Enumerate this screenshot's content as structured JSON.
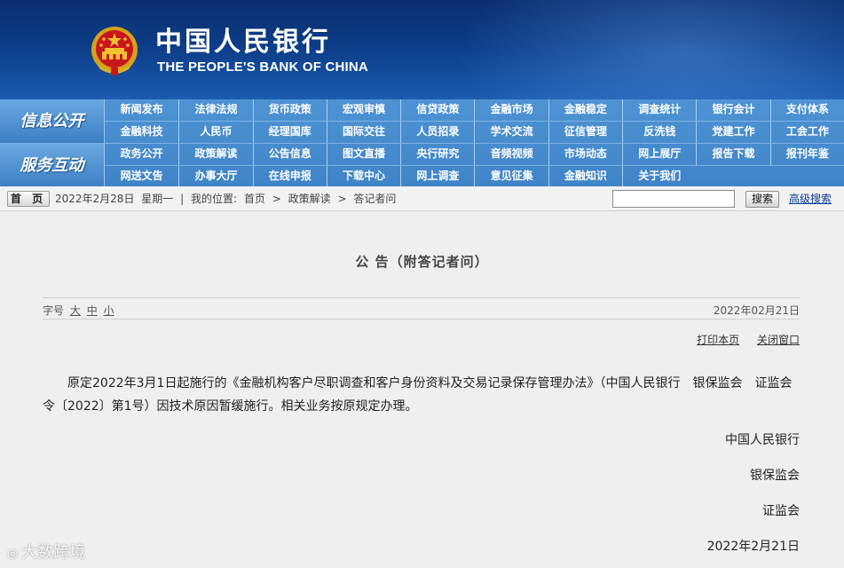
{
  "header": {
    "bank_name_cn": "中国人民银行",
    "bank_name_en": "THE PEOPLE'S BANK OF CHINA",
    "emblem_icon": "national-emblem-icon",
    "colors": {
      "banner": "#0c3c86",
      "nav": "#4a8fd0",
      "link": "#0b3c94"
    }
  },
  "nav": {
    "group1_label": "信息公开",
    "group2_label": "服务互动",
    "row1": [
      "新闻发布",
      "法律法规",
      "货币政策",
      "宏观审慎",
      "信贷政策",
      "金融市场",
      "金融稳定",
      "调查统计",
      "银行会计",
      "支付体系"
    ],
    "row2": [
      "金融科技",
      "人民币",
      "经理国库",
      "国际交往",
      "人员招录",
      "学术交流",
      "征信管理",
      "反洗钱",
      "党建工作",
      "工会工作"
    ],
    "row3": [
      "政务公开",
      "政策解读",
      "公告信息",
      "图文直播",
      "央行研究",
      "音频视频",
      "市场动态",
      "网上展厅",
      "报告下载",
      "报刊年鉴"
    ],
    "row4": [
      "网送文告",
      "办事大厅",
      "在线申报",
      "下载中心",
      "网上调查",
      "意见征集",
      "金融知识",
      "关于我们"
    ]
  },
  "breadcrumb": {
    "home_label": "首 页",
    "date": "2022年2月28日",
    "weekday": "星期一",
    "separator": "|",
    "location_label": "我的位置:",
    "items": [
      "首页",
      "政策解读",
      "答记者问"
    ],
    "arrow": ">",
    "search_button": "搜索",
    "advanced_search": "高级搜索"
  },
  "article": {
    "title": "公 告（附答记者问）",
    "font_size_label": "字号",
    "font_sizes": [
      "大",
      "中",
      "小"
    ],
    "date": "2022年02月21日",
    "print_label": "打印本页",
    "close_label": "关闭窗口",
    "body": "原定2022年3月1日起施行的《金融机构客户尽职调查和客户身份资料及交易记录保存管理办法》（中国人民银行　银保监会　证监会令〔2022〕第1号）因技术原因暂缓施行。相关业务按原规定办理。",
    "signatures": [
      "中国人民银行",
      "银保监会",
      "证监会",
      "2022年2月21日"
    ]
  },
  "watermark": "大数跨境"
}
